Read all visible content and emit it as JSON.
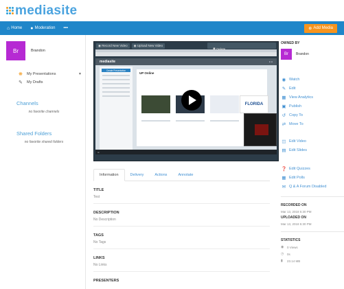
{
  "brand": {
    "name": "mediasite"
  },
  "nav": {
    "home": "Home",
    "moderation": "Moderation",
    "more": "•••",
    "add_media": "Add Media"
  },
  "sidebar": {
    "user": {
      "initials": "Br",
      "name": "Brandon"
    },
    "links": [
      {
        "label": "My Presentations",
        "icon": "presentations-icon"
      },
      {
        "label": "My Drafts",
        "icon": "edit-icon"
      }
    ],
    "channels": {
      "heading": "Channels",
      "empty": "no favorite channels"
    },
    "shared_folders": {
      "heading": "Shared Folders",
      "empty": "no favorite shared folders"
    }
  },
  "player": {
    "record_label": "Record New Video",
    "upload_label": "Upload New Video",
    "delete_label": "Delete",
    "screen_app": "mediasite",
    "screen_page_title": "UP Online",
    "screen_create_btn": "Create Presentation",
    "screen_thumb_logo": "FLORIDA"
  },
  "tabs": [
    {
      "label": "Information",
      "active": true
    },
    {
      "label": "Delivery",
      "active": false
    },
    {
      "label": "Actions",
      "active": false
    },
    {
      "label": "Annotate",
      "active": false
    }
  ],
  "details": [
    {
      "label": "TITLE",
      "value": "Test"
    },
    {
      "label": "DESCRIPTION",
      "value": "No Description"
    },
    {
      "label": "TAGS",
      "value": "No Tags"
    },
    {
      "label": "LINKS",
      "value": "No Links"
    },
    {
      "label": "PRESENTERS",
      "value": ""
    }
  ],
  "owner": {
    "heading": "OWNED BY",
    "initials": "Br",
    "name": "Brandon"
  },
  "actions_group1": [
    {
      "label": "Watch",
      "icon": "watch-icon"
    },
    {
      "label": "Edit",
      "icon": "edit-icon"
    },
    {
      "label": "View Analytics",
      "icon": "analytics-icon"
    },
    {
      "label": "Publish",
      "icon": "publish-icon"
    },
    {
      "label": "Copy To",
      "icon": "copy-icon"
    },
    {
      "label": "Move To",
      "icon": "move-icon"
    }
  ],
  "actions_group2": [
    {
      "label": "Edit Video",
      "icon": "video-icon"
    },
    {
      "label": "Edit Slides",
      "icon": "slides-icon"
    }
  ],
  "actions_group3": [
    {
      "label": "Edit Quizzes",
      "icon": "quiz-icon"
    },
    {
      "label": "Edit Polls",
      "icon": "polls-icon"
    },
    {
      "label": "Q & A Forum Disabled",
      "icon": "forum-icon"
    }
  ],
  "recorded": {
    "heading": "RECORDED ON",
    "value": "Mar 13, 2018 5:30 PM"
  },
  "uploaded": {
    "heading": "UPLOADED ON",
    "value": "Mar 13, 2018 5:30 PM"
  },
  "statistics": {
    "heading": "STATISTICS",
    "views": "0 Views",
    "duration": "0s",
    "size": "23.14 MB"
  },
  "colors": {
    "nav": "#1f86c9",
    "accent": "#f7941d",
    "avatar": "#b62ad3",
    "link": "#3f8fd2"
  }
}
